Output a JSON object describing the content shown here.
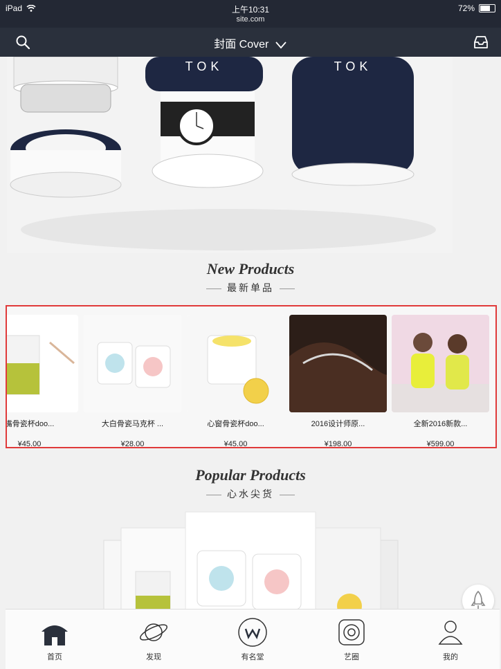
{
  "status_bar": {
    "device": "iPad",
    "time": "上午10:31",
    "url": "site.com",
    "battery": "72%",
    "battery_level": 0.72
  },
  "nav": {
    "title": "封面 Cover"
  },
  "new_products": {
    "title": "New Products",
    "subtitle": "最新单品",
    "items": [
      {
        "name": "嘴骨瓷杯doo...",
        "price": "¥45.00"
      },
      {
        "name": "大白骨瓷马克杯 ...",
        "price": "¥28.00"
      },
      {
        "name": "心窗骨瓷杯doo...",
        "price": "¥45.00"
      },
      {
        "name": "2016设计师原...",
        "price": "¥198.00"
      },
      {
        "name": "全新2016新款...",
        "price": "¥599.00"
      }
    ]
  },
  "hero": {
    "brand_text": "TOK"
  },
  "popular_products": {
    "title": "Popular Products",
    "subtitle": "心水尖货"
  },
  "tabs": [
    {
      "label": "首页",
      "icon": "home-icon",
      "active": true
    },
    {
      "label": "发现",
      "icon": "planet-icon",
      "active": false
    },
    {
      "label": "有名堂",
      "icon": "w-circle-icon",
      "active": false
    },
    {
      "label": "艺圈",
      "icon": "target-icon",
      "active": false
    },
    {
      "label": "我的",
      "icon": "user-icon",
      "active": false
    }
  ],
  "colors": {
    "nav_bg": "#2a303c",
    "status_bg": "#232834",
    "highlight": "#e03a3a"
  }
}
